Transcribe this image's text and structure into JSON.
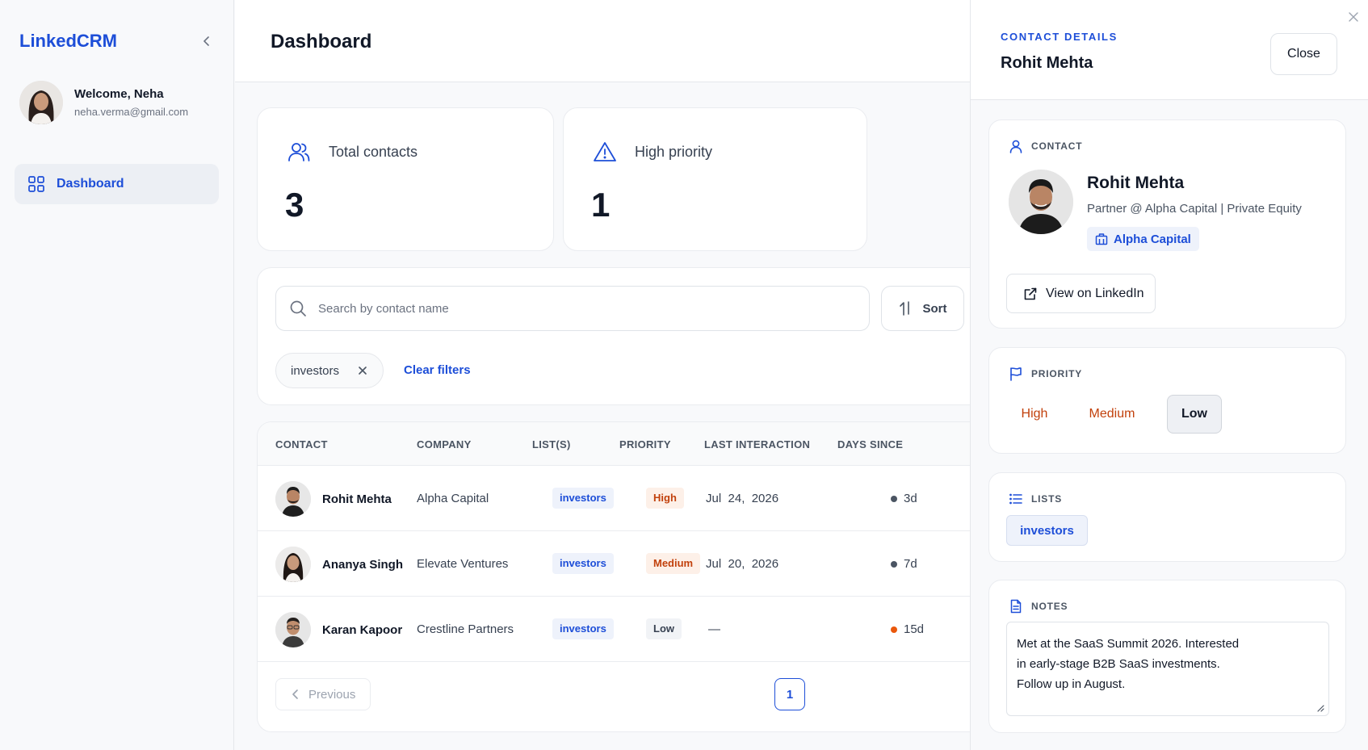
{
  "sidebar": {
    "brand": "LinkedCRM",
    "user": {
      "greeting": "Welcome, Neha",
      "email": "neha.verma@gmail.com"
    },
    "nav": [
      {
        "label": "Dashboard",
        "icon": "grid-icon",
        "active": true
      }
    ]
  },
  "header": {
    "title": "Dashboard"
  },
  "stats": [
    {
      "label": "Total contacts",
      "value": "3",
      "icon": "users-icon"
    },
    {
      "label": "High priority",
      "value": "1",
      "icon": "alert-triangle-icon"
    }
  ],
  "filters": {
    "search_placeholder": "Search by contact name",
    "search_value": "",
    "sort_label": "Sort",
    "active_chip": "investors",
    "clear_label": "Clear filters"
  },
  "table": {
    "columns": [
      "CONTACT",
      "COMPANY",
      "LIST(S)",
      "PRIORITY",
      "LAST INTERACTION",
      "DAYS SINCE"
    ],
    "rows": [
      {
        "name": "Rohit Mehta",
        "company": "Alpha Capital",
        "list": "investors",
        "priority": "High",
        "last": "Jul  24,  2026",
        "days": "3d"
      },
      {
        "name": "Ananya Singh",
        "company": "Elevate Ventures",
        "list": "investors",
        "priority": "Medium",
        "last": "Jul  20,  2026",
        "days": "7d"
      },
      {
        "name": "Karan Kapoor",
        "company": "Crestline Partners",
        "list": "investors",
        "priority": "Low",
        "last": "—",
        "days": "15d"
      }
    ],
    "pagination": {
      "prev_label": "Previous",
      "current_page": "1"
    }
  },
  "details": {
    "kicker": "CONTACT DETAILS",
    "name": "Rohit Mehta",
    "close_label": "Close",
    "contact": {
      "section_label": "CONTACT",
      "name": "Rohit Mehta",
      "title": "Partner @ Alpha Capital | Private Equity",
      "company": "Alpha Capital",
      "linkedin_label": "View on LinkedIn"
    },
    "priority": {
      "section_label": "PRIORITY",
      "options": [
        "High",
        "Medium",
        "Low"
      ],
      "selected": "Low"
    },
    "lists": {
      "section_label": "LISTS",
      "items": [
        "investors"
      ]
    },
    "notes": {
      "section_label": "NOTES",
      "lines": [
        "Met at the SaaS Summit 2026. Interested",
        "in early-stage B2B SaaS investments.",
        "Follow up in August."
      ]
    }
  },
  "colors": {
    "accent": "#1d4ed8",
    "warning": "#c2410c",
    "bg": "#f8f9fb"
  }
}
